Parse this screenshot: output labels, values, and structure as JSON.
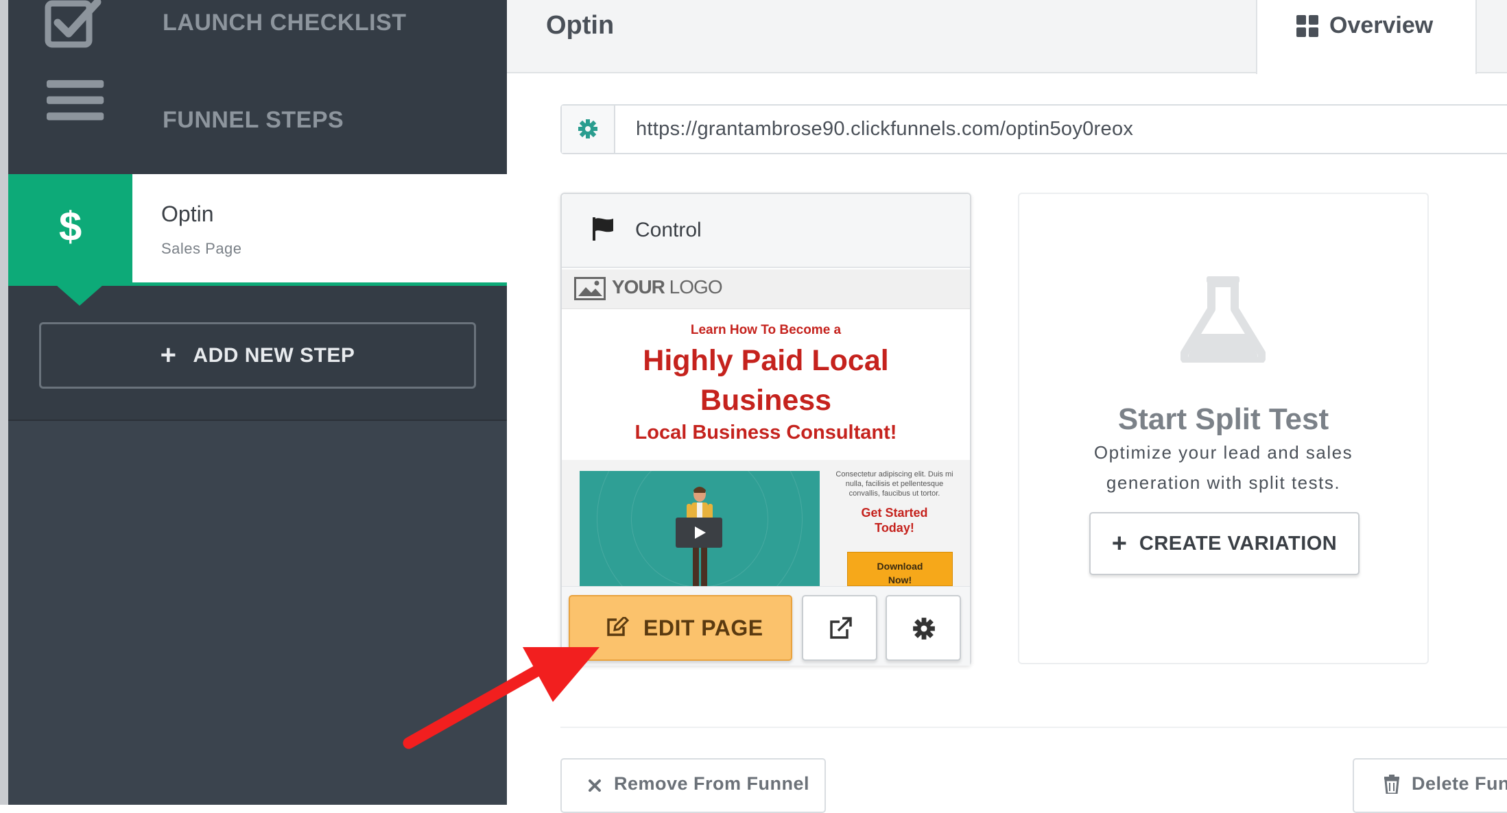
{
  "sidebar": {
    "nav": [
      {
        "label": "LAUNCH CHECKLIST",
        "icon": "checkbox-icon"
      },
      {
        "label": "FUNNEL STEPS",
        "icon": "menu-lines-icon"
      }
    ],
    "step": {
      "title": "Optin",
      "subtitle": "Sales Page",
      "icon": "$",
      "icon_name": "dollar-icon"
    },
    "add_step_label": "ADD NEW STEP"
  },
  "header": {
    "page_title": "Optin",
    "tab_overview": "Overview"
  },
  "url_bar": {
    "url": "https://grantambrose90.clickfunnels.com/optin5oy0reox",
    "icon": "gear-icon"
  },
  "control_card": {
    "label": "Control",
    "preview": {
      "logo_your": "YOUR",
      "logo_logo": " LOGO",
      "pre_headline": "Learn How To Become a",
      "headline_line1": "Highly Paid Local",
      "headline_line2": "Business",
      "subheadline": "Local Business Consultant!",
      "body_text": "Consectetur adipiscing elit. Duis mi nulla, facilisis et pellentesque convallis, faucibus ut tortor.",
      "cta_line1": "Get Started",
      "cta_line2": "Today!",
      "download_line1": "Download",
      "download_line2": "Now!"
    },
    "edit_label": "EDIT PAGE"
  },
  "split_test": {
    "title": "Start Split Test",
    "description": "Optimize your lead and sales generation with split tests.",
    "create_label": "CREATE VARIATION"
  },
  "footer": {
    "remove_label": "Remove From Funnel",
    "delete_label": "Delete Fun"
  },
  "colors": {
    "sidebar_dark": "#343c45",
    "accent_green": "#0daa78",
    "edit_button": "#fbc26c",
    "headline_red": "#c5221d",
    "annotation_red": "#f21f1f"
  }
}
